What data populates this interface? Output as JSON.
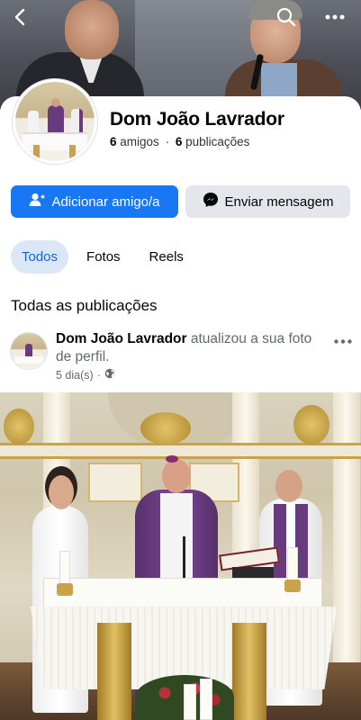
{
  "profile": {
    "name": "Dom João Lavrador",
    "friends_count": "6",
    "friends_label": "amigos",
    "separator": "·",
    "posts_count": "6",
    "posts_label": "publicações"
  },
  "actions": {
    "add_friend": "Adicionar amigo/a",
    "send_message": "Enviar mensagem"
  },
  "tabs": [
    {
      "label": "Todos",
      "active": true
    },
    {
      "label": "Fotos",
      "active": false
    },
    {
      "label": "Reels",
      "active": false
    }
  ],
  "section_title": "Todas as publicações",
  "post": {
    "author": "Dom João Lavrador",
    "action_text": "atualizou a sua foto de perfil.",
    "time": "5 dia(s)",
    "audience_icon": "globe-icon"
  },
  "icons": {
    "back": "back-arrow-icon",
    "search": "search-icon",
    "more": "more-icon",
    "add_friend": "add-person-icon",
    "messenger": "messenger-icon"
  },
  "colors": {
    "primary": "#1877f2",
    "secondary_button": "#e4e6eb",
    "active_tab_bg": "#dbe7f6",
    "active_tab_text": "#1864c8",
    "meta_text": "#65676b"
  }
}
